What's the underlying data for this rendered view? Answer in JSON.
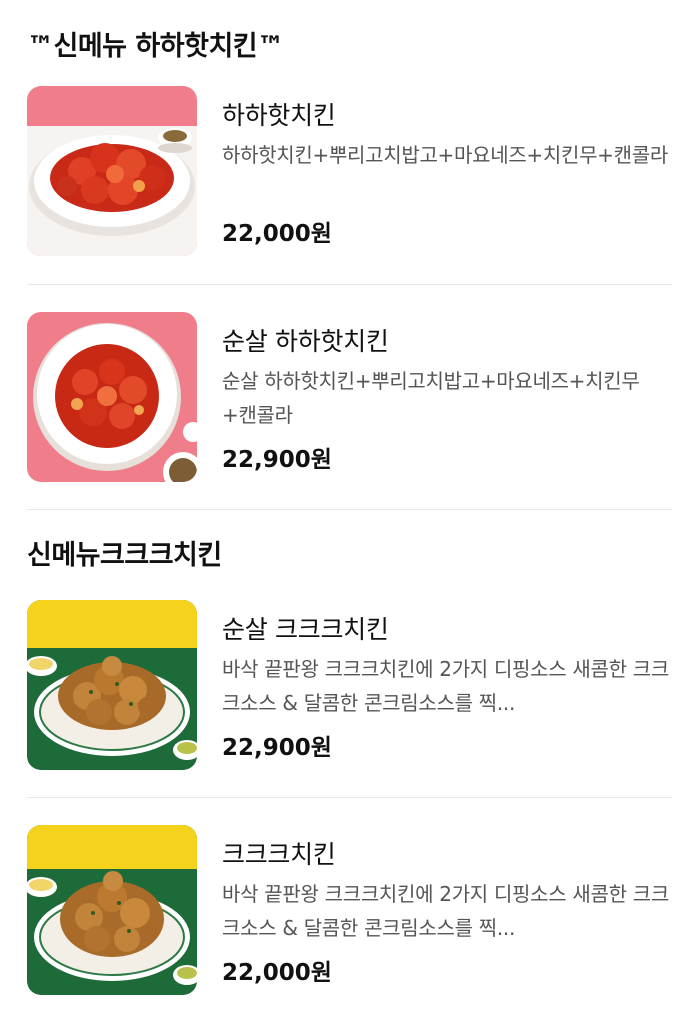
{
  "sections": [
    {
      "title": "™신메뉴 하하핫치킨™",
      "items": [
        {
          "name": "하하핫치킨",
          "description": "하하핫치킨+뿌리고치밥고+마요네즈+치킨무+캔콜라",
          "price": "22,000원",
          "image_icon": "spicy-chicken-plate-icon"
        },
        {
          "name": "순살 하하핫치킨",
          "description": "순살 하하핫치킨+뿌리고치밥고+마요네즈+치킨무+캔콜라",
          "price": "22,900원",
          "image_icon": "boneless-spicy-chicken-plate-icon"
        }
      ]
    },
    {
      "title": "신메뉴크크크치킨",
      "items": [
        {
          "name": "순살 크크크치킨",
          "description": "바삭 끝판왕 크크크치킨에 2가지 디핑소스 새콤한 크크크소스 & 달콤한 콘크림소스를 찍...",
          "price": "22,900원",
          "image_icon": "boneless-crispy-chicken-plate-icon"
        },
        {
          "name": "크크크치킨",
          "description": "바삭 끝판왕 크크크치킨에 2가지 디핑소스 새콤한 크크크소스 & 달콤한 콘크림소스를 찍...",
          "price": "22,000원",
          "image_icon": "crispy-chicken-plate-icon"
        }
      ]
    }
  ],
  "colors": {
    "pink_background": "#f07d8a",
    "yellow_background": "#f5d21c",
    "green_background": "#1e6b3a",
    "spicy_sauce": "#d8321c",
    "crispy_fried": "#b9782e"
  }
}
